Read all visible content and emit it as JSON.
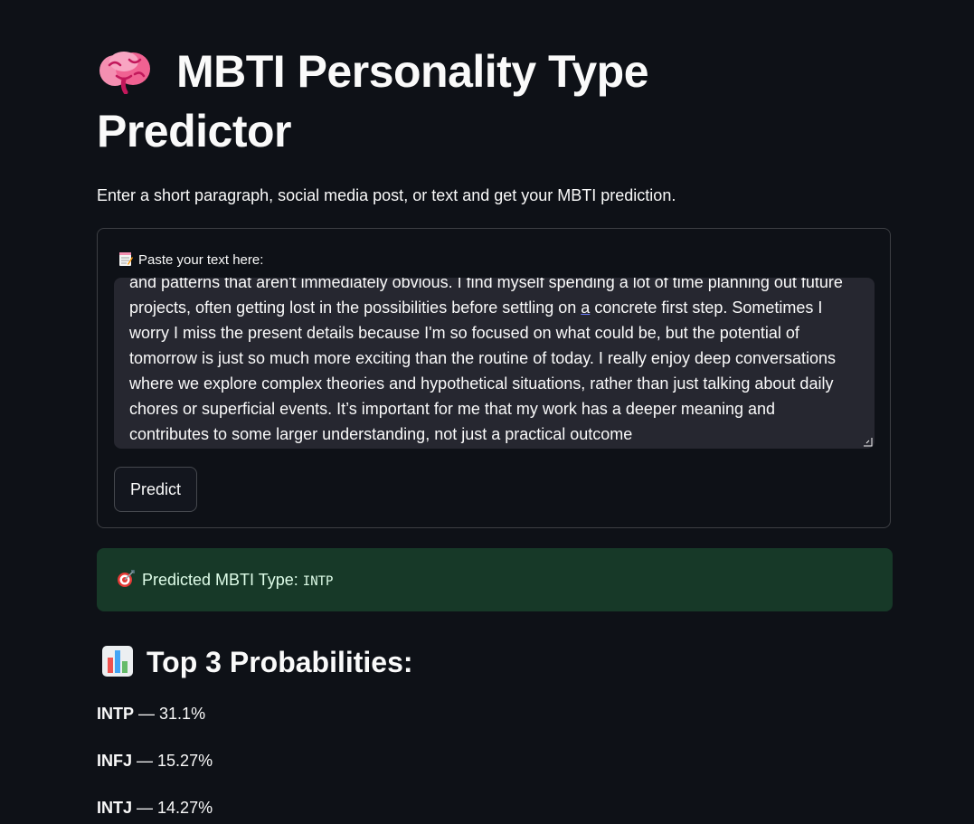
{
  "header": {
    "title": "MBTI Personality Type Predictor",
    "subtitle": "Enter a short paragraph, social media post, or text and get your MBTI prediction.",
    "title_icon": "brain-icon"
  },
  "form": {
    "label": "Paste your text here:",
    "label_icon": "memo-icon",
    "text_before_link": "and patterns that aren't immediately obvious. I find myself spending a lot of time planning out future projects, often getting lost in the possibilities before settling on ",
    "text_link": "a",
    "text_after_link": " concrete first step. Sometimes I worry I miss the present details because I'm so focused on what could be, but the potential of tomorrow is just so much more exciting than the routine of today. I really enjoy deep conversations where we explore complex theories and hypothetical situations, rather than just talking about daily chores or superficial events. It’s important for me that my work has a deeper meaning and contributes to some larger understanding, not just a practical outcome",
    "button_label": "Predict"
  },
  "result": {
    "icon": "target-icon",
    "label": "Predicted MBTI Type:",
    "type": "INTP",
    "color": "#173928"
  },
  "probabilities": {
    "icon": "bar-chart-icon",
    "heading": "Top 3 Probabilities:",
    "items": [
      {
        "type": "INTP",
        "separator": " — ",
        "value": "31.1%"
      },
      {
        "type": "INFJ",
        "separator": " — ",
        "value": "15.27%"
      },
      {
        "type": "INTJ",
        "separator": " — ",
        "value": "14.27%"
      }
    ]
  }
}
